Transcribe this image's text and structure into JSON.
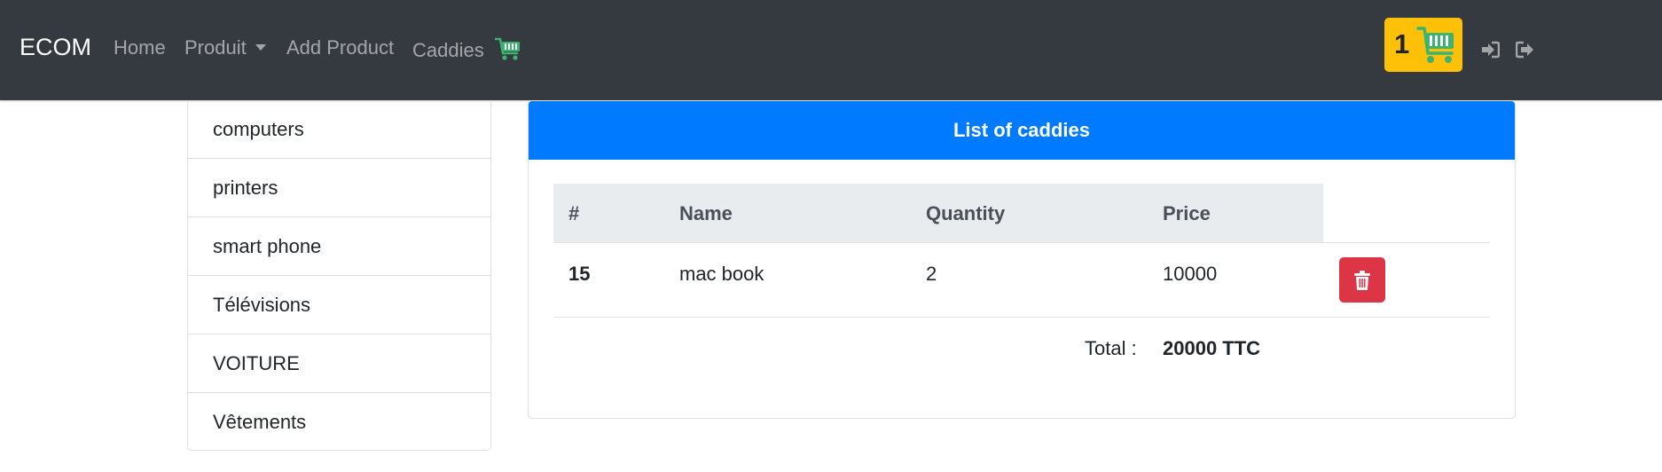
{
  "navbar": {
    "brand": "ECOM",
    "links": {
      "home": "Home",
      "produit": "Produit",
      "add_product": "Add Product",
      "caddies": "Caddies"
    },
    "cart_count": "1",
    "background": "#343a40",
    "badge_color": "#ffc107",
    "icons": [
      "shopping-cart-icon",
      "sign-in-icon",
      "sign-out-icon",
      "caret-down-icon"
    ]
  },
  "sidebar": {
    "categories": [
      "computers",
      "printers",
      "smart phone",
      "Télévisions",
      "VOITURE",
      "Vêtements"
    ]
  },
  "caddies": {
    "title": "List of caddies",
    "header_color": "#007bff",
    "columns": [
      "#",
      "Name",
      "Quantity",
      "Price"
    ],
    "rows": [
      {
        "id": "15",
        "name": "mac book",
        "quantity": "2",
        "price": "10000"
      }
    ],
    "total_label": "Total :",
    "total_value": "20000 TTC",
    "delete_color": "#dc3545"
  }
}
